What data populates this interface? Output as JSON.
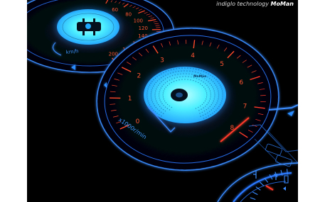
{
  "watermark": {
    "text": "indiglo technology",
    "brand": "MoMan"
  },
  "speedometer": {
    "unit": "km/h",
    "ticks": [
      "60",
      "80",
      "100",
      "120",
      "140",
      "160",
      "180",
      "200"
    ]
  },
  "tachometer": {
    "unit": "x1000r/min",
    "ticks": [
      "0",
      "1",
      "2",
      "3",
      "4",
      "5",
      "6",
      "7",
      "8"
    ],
    "brand_mark": "MoMan"
  },
  "colors": {
    "glow": "#2f8fff",
    "face": "#38e8ff",
    "redline": "#ff3a2a",
    "background": "#000000"
  },
  "icons": [
    "fuel-icon",
    "temperature-icon",
    "turn-signal-icon"
  ]
}
